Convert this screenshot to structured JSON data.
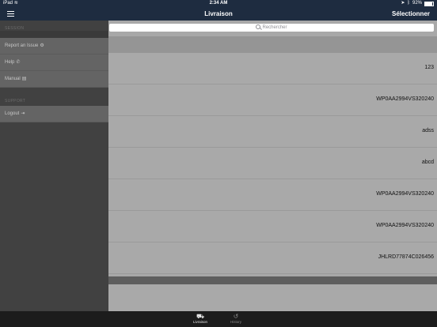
{
  "status": {
    "device": "iPad",
    "time": "2:34 AM",
    "battery": "92%",
    "battery_level": 0.92
  },
  "nav": {
    "title": "Livraison",
    "right_button": "Sélectionner"
  },
  "search": {
    "placeholder": "Rechercher"
  },
  "list": {
    "rows": [
      "123",
      "WP0AA2994VS320240",
      "adss",
      "abcd",
      "WP0AA2994VS320240",
      "WP0AA2994VS320240",
      "JHLRD77874C026456"
    ]
  },
  "sidebar": {
    "section1": "SESSION",
    "items1": [
      {
        "label": "Report an Issue",
        "icon": "bug-icon"
      },
      {
        "label": "Help",
        "icon": "phone-icon"
      },
      {
        "label": "Manual",
        "icon": "book-icon"
      }
    ],
    "section2": "SUPPORT",
    "items2": [
      {
        "label": "Logout",
        "icon": "logout-icon"
      }
    ]
  },
  "tabs": [
    {
      "label": "Livraison",
      "icon": "truck-icon",
      "active": true
    },
    {
      "label": "History",
      "icon": "history-icon",
      "active": false
    }
  ]
}
